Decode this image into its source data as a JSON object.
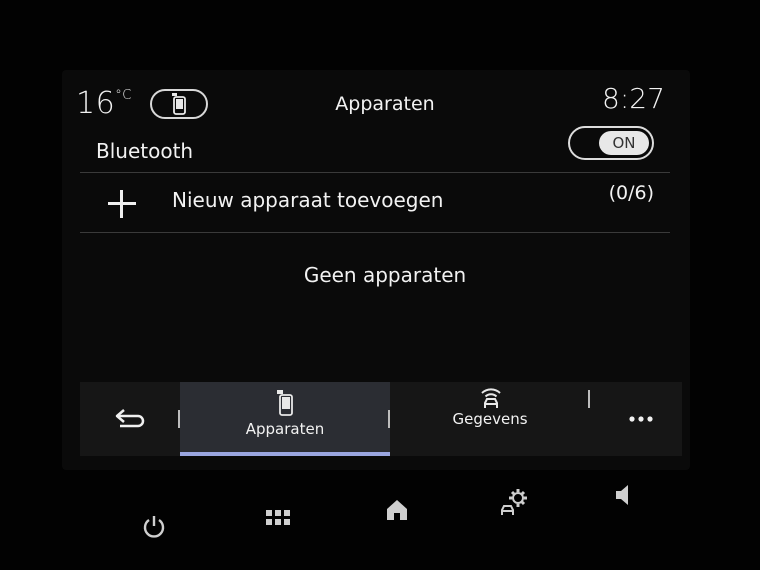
{
  "header": {
    "temperature": "16",
    "temperature_unit": "°C",
    "title": "Apparaten",
    "clock": "8:27"
  },
  "bluetooth": {
    "label": "Bluetooth",
    "toggle_state": "ON"
  },
  "add_device": {
    "label": "Nieuw apparaat toevoegen",
    "count": "(0/6)"
  },
  "empty_message": "Geen apparaten",
  "tabs": [
    {
      "label": "Apparaten",
      "icon": "phone-icon",
      "active": true
    },
    {
      "label": "Gegevens",
      "icon": "wifi-car-icon",
      "active": false
    }
  ],
  "hardware_buttons": [
    "power-icon",
    "apps-grid-icon",
    "home-icon",
    "car-settings-icon",
    "volume-icon"
  ],
  "colors": {
    "accent": "#9aa6e0",
    "background": "#0a0a0a",
    "tab_active": "#2b2d33"
  }
}
